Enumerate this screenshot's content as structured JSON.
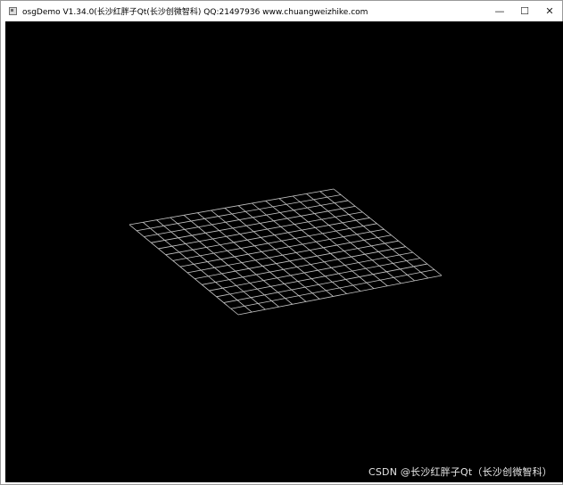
{
  "window": {
    "title": "osgDemo V1.34.0(长沙红胖子Qt(长沙创微智科) QQ:21497936 www.chuangweizhike.com",
    "icon": "app-window-icon",
    "controls": {
      "minimize_glyph": "—",
      "maximize_glyph": "☐",
      "close_glyph": "✕"
    }
  },
  "scene": {
    "background": "#000000",
    "grid_color": "#c8c8c8",
    "grid_divisions": 15
  },
  "watermark": {
    "text": "CSDN @长沙红胖子Qt（长沙创微智科）"
  }
}
